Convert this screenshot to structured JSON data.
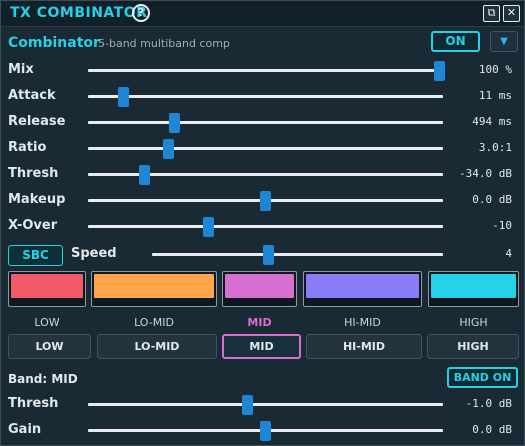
{
  "titlebar": {
    "title": "TX COMBINATOR",
    "help_glyph": "?",
    "detach_glyph": "⧉",
    "close_glyph": "✕"
  },
  "header": {
    "preset_name": "Combinator",
    "preset_desc": "5-band multiband comp",
    "on_label": "ON",
    "menu_glyph": "▼"
  },
  "params": [
    {
      "label": "Mix",
      "value": "100 %",
      "level": 0.99
    },
    {
      "label": "Attack",
      "value": "11 ms",
      "level": 0.1
    },
    {
      "label": "Release",
      "value": "494 ms",
      "level": 0.245
    },
    {
      "label": "Ratio",
      "value": "3.0:1",
      "level": 0.228
    },
    {
      "label": "Thresh",
      "value": "-34.0 dB",
      "level": 0.16
    },
    {
      "label": "Makeup",
      "value": "0.0 dB",
      "level": 0.5
    },
    {
      "label": "X-Over",
      "value": "-10",
      "level": 0.34
    }
  ],
  "speed": {
    "button_label": "SBC",
    "label": "Speed",
    "value": "4",
    "level": 0.4
  },
  "bands": [
    {
      "label": "LOW",
      "color": "#f25a6a"
    },
    {
      "label": "LO-MID",
      "color": "#ffa64a"
    },
    {
      "label": "MID",
      "color": "#d86fd0"
    },
    {
      "label": "HI-MID",
      "color": "#8a7cf6"
    },
    {
      "label": "HIGH",
      "color": "#24d3ea"
    }
  ],
  "selected_band": "MID",
  "band_section": {
    "title": "Band: MID",
    "band_on_label": "BAND ON",
    "params": [
      {
        "label": "Thresh",
        "value": "-1.0 dB",
        "level": 0.45
      },
      {
        "label": "Gain",
        "value": "0.0 dB",
        "level": 0.5
      }
    ]
  },
  "colors": {
    "accent": "#26d0e6",
    "thumb": "#1f86d6",
    "selected": "#d86fd0"
  }
}
